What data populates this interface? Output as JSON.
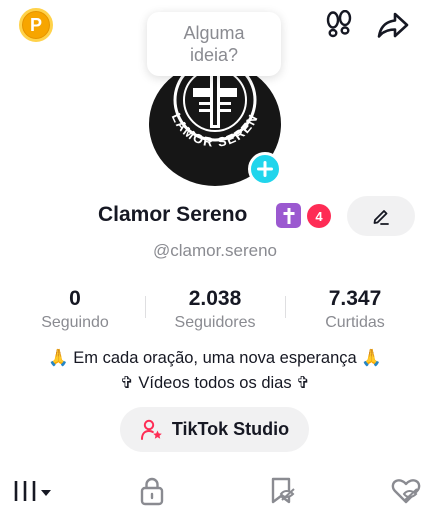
{
  "promo": {
    "letter": "P"
  },
  "tooltip": {
    "text": "Alguma ideia?"
  },
  "avatar": {
    "ring_text": "CLAMOR SERENO"
  },
  "profile": {
    "display_name": "Clamor Sereno",
    "badge_count": "4",
    "username": "@clamor.sereno"
  },
  "stats": [
    {
      "value": "0",
      "label": "Seguindo"
    },
    {
      "value": "2.038",
      "label": "Seguidores"
    },
    {
      "value": "7.347",
      "label": "Curtidas"
    }
  ],
  "bio": {
    "line1": "🙏 Em cada oração, uma nova esperança 🙏",
    "line2": "✞ Vídeos todos os dias ✞"
  },
  "studio": {
    "label": "TikTok Studio"
  },
  "colors": {
    "accent_red": "#fe2c55",
    "cyan": "#20d5ec",
    "promo": "#f7a500",
    "emoji_purple": "#9b59d0"
  },
  "icons": [
    "promo-coin-icon",
    "footprints-icon",
    "share-arrow-icon",
    "plus-icon",
    "edit-pencil-icon",
    "person-star-icon",
    "grid-menu-icon",
    "lock-icon",
    "bookmark-hidden-icon",
    "liked-hidden-icon"
  ]
}
